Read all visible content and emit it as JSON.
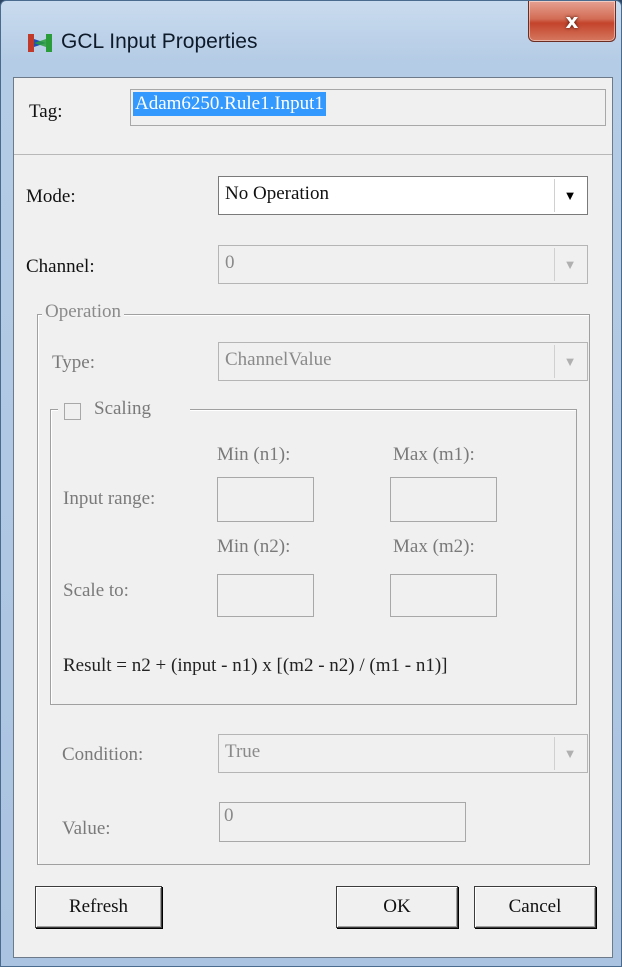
{
  "window": {
    "title": "GCL Input Properties",
    "icon": "gcl-app-icon",
    "close_glyph": "x"
  },
  "tag": {
    "label": "Tag:",
    "value": "Adam6250.Rule1.Input1"
  },
  "mode": {
    "label": "Mode:",
    "value": "No Operation"
  },
  "channel": {
    "label": "Channel:",
    "value": "0"
  },
  "operation": {
    "legend": "Operation",
    "type_label": "Type:",
    "type_value": "ChannelValue",
    "scaling": {
      "label": "Scaling",
      "checked": false,
      "min1_label": "Min (n1):",
      "max1_label": "Max (m1):",
      "input_range_label": "Input range:",
      "min2_label": "Min (n2):",
      "max2_label": "Max (m2):",
      "scale_to_label": "Scale to:",
      "n1": "",
      "m1": "",
      "n2": "",
      "m2": "",
      "formula": "Result = n2 + (input - n1) x [(m2 - n2) / (m1 - n1)]"
    },
    "condition_label": "Condition:",
    "condition_value": "True",
    "value_label": "Value:",
    "value_value": "0"
  },
  "buttons": {
    "refresh": "Refresh",
    "ok": "OK",
    "cancel": "Cancel"
  },
  "arrow_glyph": "▼"
}
